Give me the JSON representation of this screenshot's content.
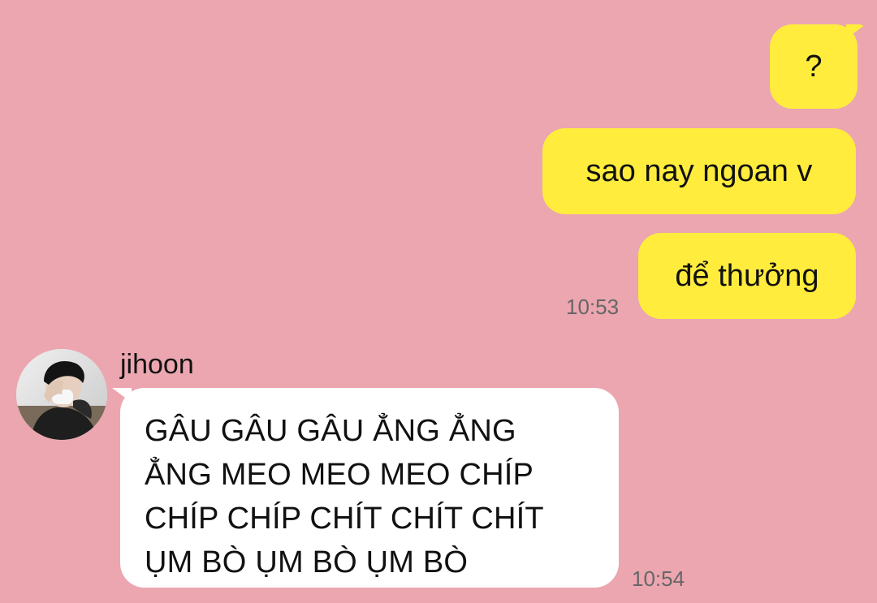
{
  "chat": {
    "outgoing": [
      {
        "text": "?"
      },
      {
        "text": "sao nay ngoan v"
      },
      {
        "text": "để thưởng"
      }
    ],
    "outgoing_time": "10:53",
    "incoming": {
      "sender": "jihoon",
      "text": "GÂU GÂU GÂU ẲNG ẲNG\nẲNG MEO MEO MEO CHÍP\nCHÍP CHÍP CHÍT CHÍT CHÍT\nỤM BÒ ỤM BÒ ỤM BÒ",
      "time": "10:54"
    }
  },
  "colors": {
    "background": "#eba6b0",
    "outgoing_bubble": "#ffec3d",
    "incoming_bubble": "#ffffff",
    "timestamp": "#666666"
  }
}
